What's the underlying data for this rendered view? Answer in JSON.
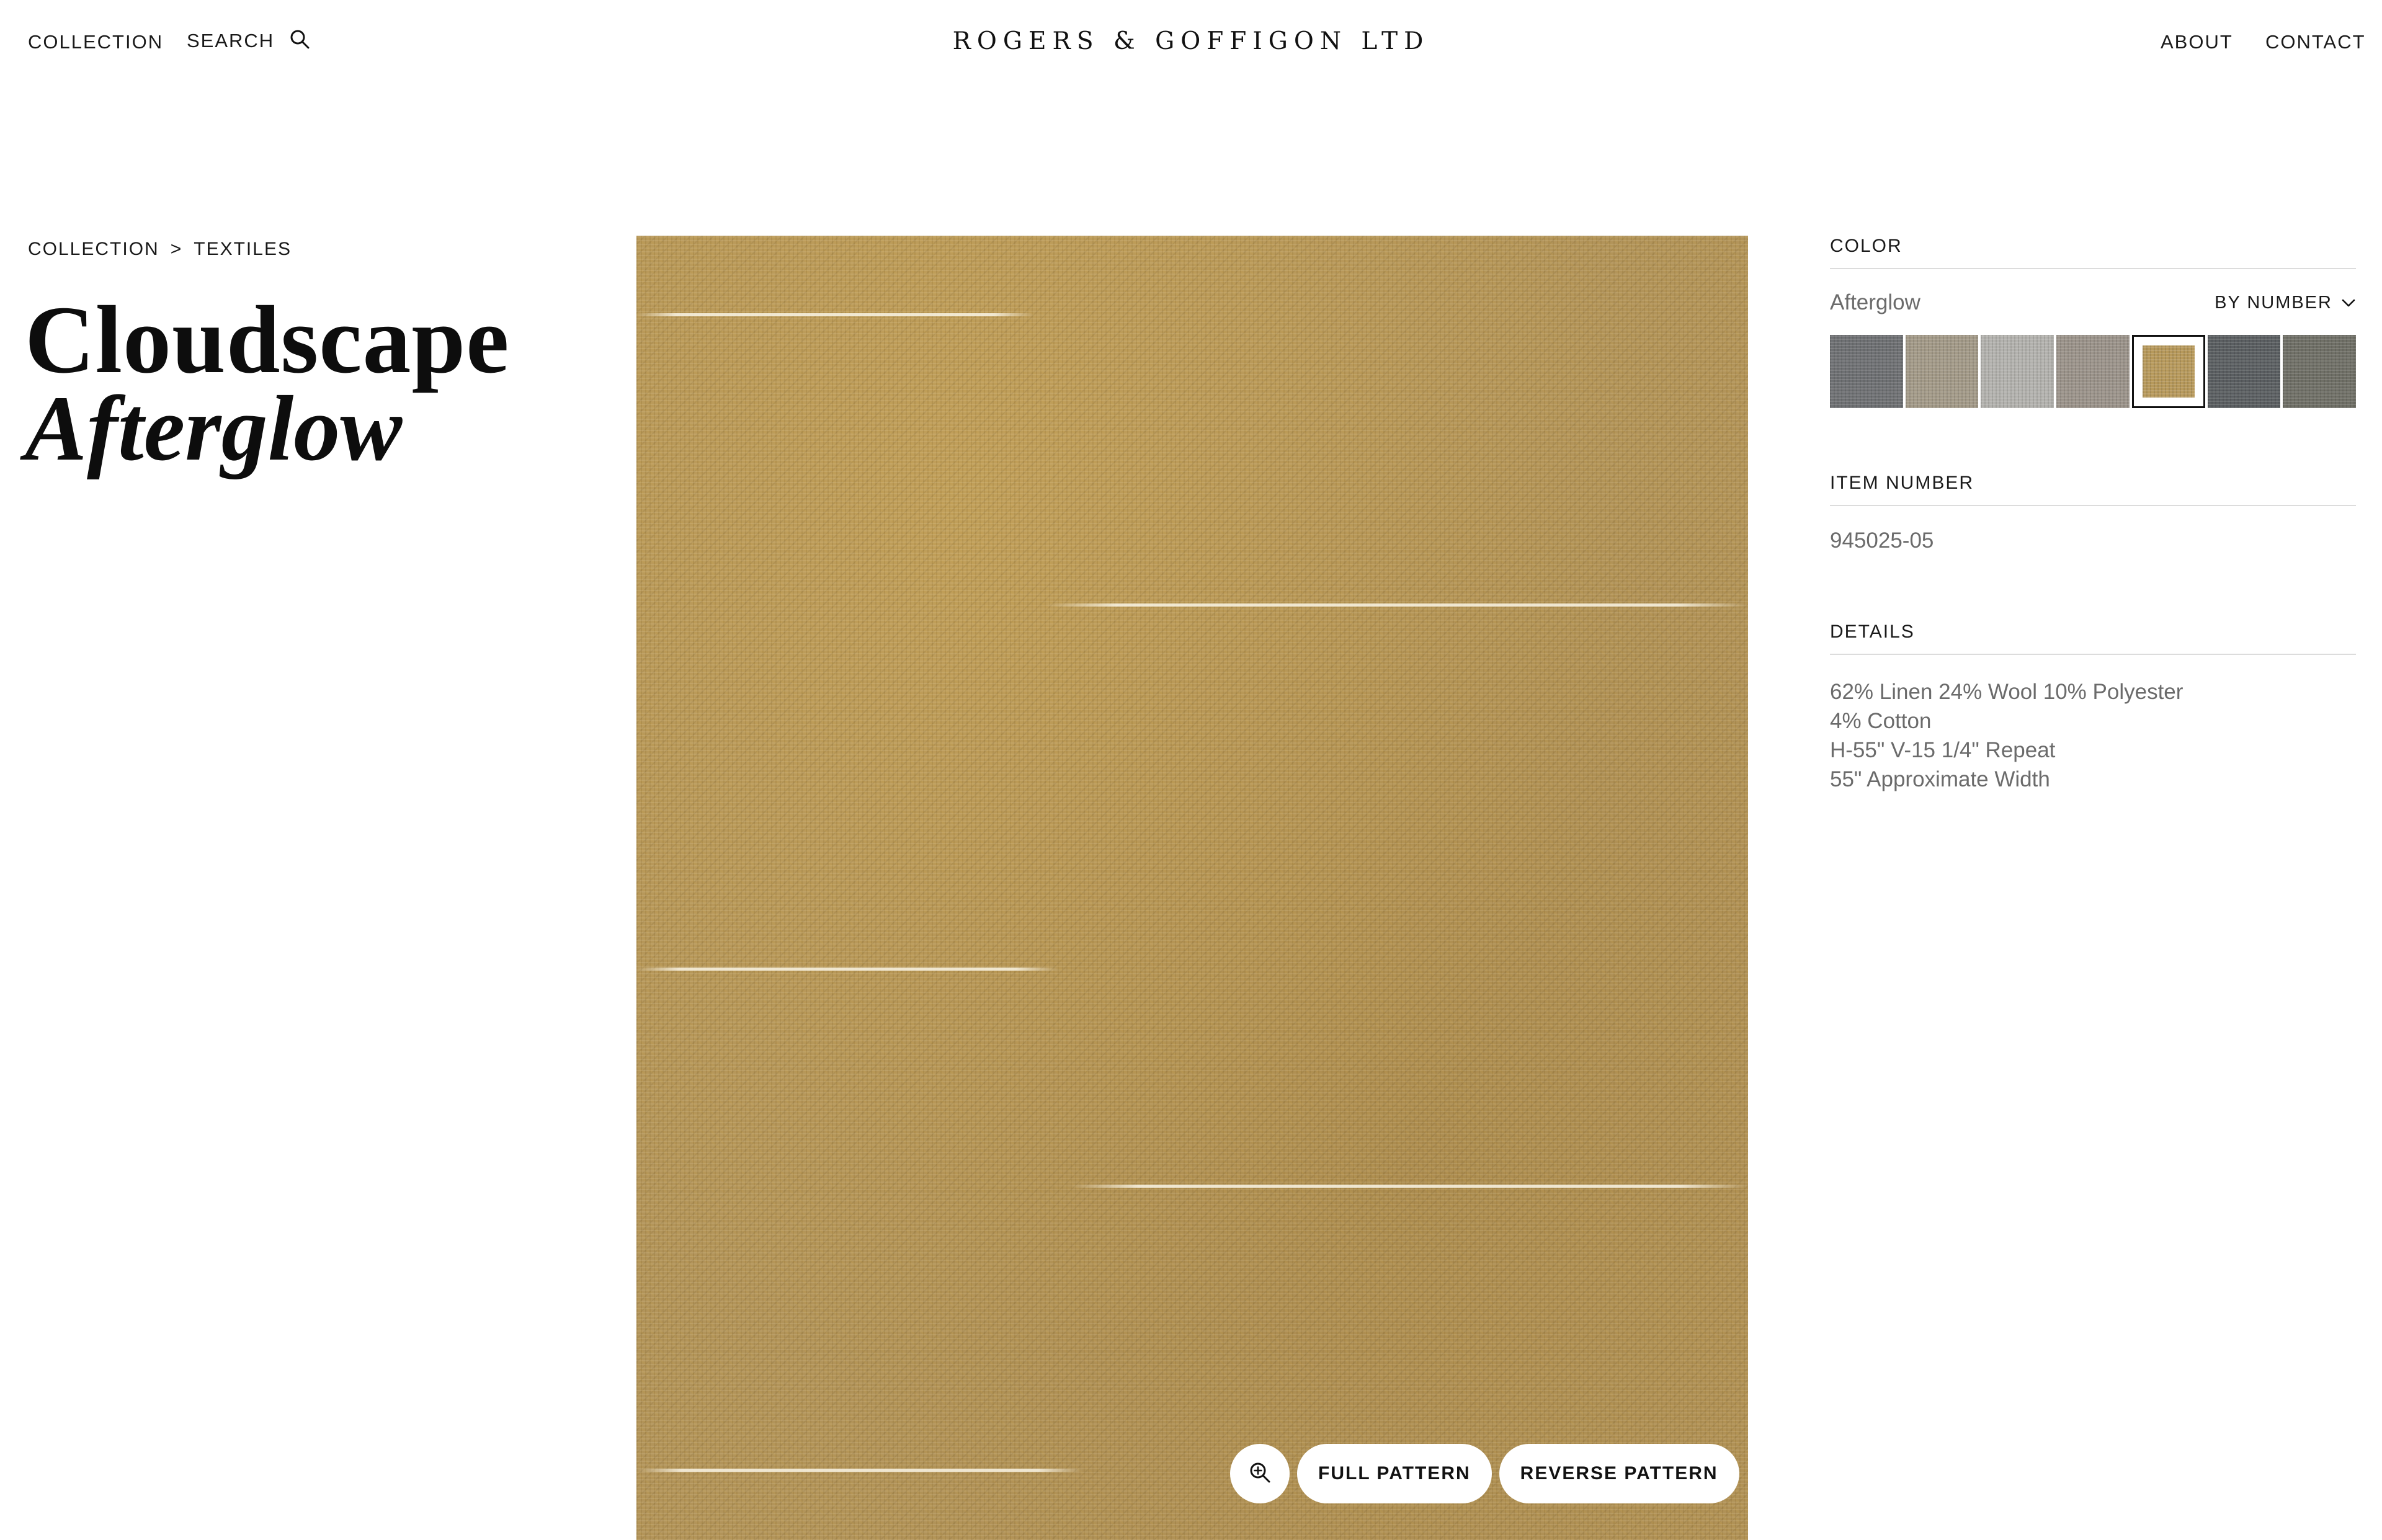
{
  "header": {
    "nav_collection": "COLLECTION",
    "nav_search": "SEARCH",
    "brand": "ROGERS & GOFFIGON LTD",
    "nav_about": "ABOUT",
    "nav_contact": "CONTACT"
  },
  "breadcrumb": {
    "root": "COLLECTION",
    "separator": ">",
    "current": "TEXTILES"
  },
  "product": {
    "name": "Cloudscape",
    "colorway": "Afterglow"
  },
  "image_controls": {
    "zoom_icon": "zoom-in-icon",
    "full_pattern": "FULL PATTERN",
    "reverse_pattern": "REVERSE PATTERN"
  },
  "color": {
    "label": "COLOR",
    "selected_name": "Afterglow",
    "sort_label": "BY NUMBER",
    "swatches": [
      {
        "color": "#6e7073"
      },
      {
        "color": "#a39a88"
      },
      {
        "color": "#b3b2ae"
      },
      {
        "color": "#9b938a"
      },
      {
        "color": "#b7995b",
        "selected": true
      },
      {
        "color": "#5a5e61"
      },
      {
        "color": "#6f6f66"
      }
    ]
  },
  "item_number": {
    "label": "ITEM NUMBER",
    "value": "945025-05"
  },
  "details": {
    "label": "DETAILS",
    "lines": [
      "62% Linen 24% Wool 10% Polyester",
      "4% Cotton",
      "H-55\" V-15 1/4\" Repeat",
      "55\" Approximate Width"
    ]
  }
}
